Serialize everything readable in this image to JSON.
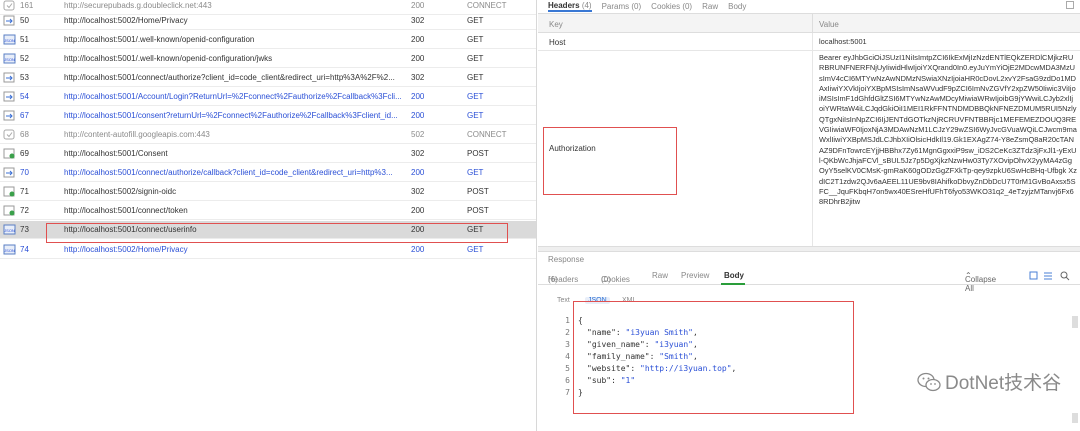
{
  "requests": [
    {
      "id": "161",
      "url": "http://securepubads.g.doubleclick.net:443",
      "status": "200",
      "method": "CONNECT",
      "style": "grey"
    },
    {
      "id": "50",
      "url": "http://localhost:5002/Home/Privacy",
      "status": "302",
      "method": "GET",
      "style": ""
    },
    {
      "id": "51",
      "url": "http://localhost:5001/.well-known/openid-configuration",
      "status": "200",
      "method": "GET",
      "style": ""
    },
    {
      "id": "52",
      "url": "http://localhost:5001/.well-known/openid-configuration/jwks",
      "status": "200",
      "method": "GET",
      "style": ""
    },
    {
      "id": "53",
      "url": "http://localhost:5001/connect/authorize?client_id=code_client&redirect_uri=http%3A%2F%2...",
      "status": "302",
      "method": "GET",
      "style": ""
    },
    {
      "id": "54",
      "url": "http://localhost:5001/Account/Login?ReturnUrl=%2Fconnect%2Fauthorize%2Fcallback%3Fcli...",
      "status": "200",
      "method": "GET",
      "style": "blue"
    },
    {
      "id": "67",
      "url": "http://localhost:5001/consent?returnUrl=%2Fconnect%2Fauthorize%2Fcallback%3Fclient_id...",
      "status": "200",
      "method": "GET",
      "style": "blue"
    },
    {
      "id": "68",
      "url": "http://content-autofill.googleapis.com:443",
      "status": "502",
      "method": "CONNECT",
      "style": "grey"
    },
    {
      "id": "69",
      "url": "http://localhost:5001/Consent",
      "status": "302",
      "method": "POST",
      "style": ""
    },
    {
      "id": "70",
      "url": "http://localhost:5001/connect/authorize/callback?client_id=code_client&redirect_uri=http%3...",
      "status": "200",
      "method": "GET",
      "style": "blue"
    },
    {
      "id": "71",
      "url": "http://localhost:5002/signin-oidc",
      "status": "302",
      "method": "POST",
      "style": ""
    },
    {
      "id": "72",
      "url": "http://localhost:5001/connect/token",
      "status": "200",
      "method": "POST",
      "style": ""
    },
    {
      "id": "73",
      "url": "http://localhost:5001/connect/userinfo",
      "status": "200",
      "method": "GET",
      "style": "sel"
    },
    {
      "id": "74",
      "url": "http://localhost:5002/Home/Privacy",
      "status": "200",
      "method": "GET",
      "style": "blue"
    }
  ],
  "request_tabs": {
    "headers": "Headers",
    "headers_count": "(4)",
    "params": "Params",
    "params_count": "(0)",
    "cookies": "Cookies",
    "cookies_count": "(0)",
    "raw": "Raw",
    "body": "Body"
  },
  "kv_header": {
    "key": "Key",
    "value": "Value"
  },
  "kv": {
    "host_key": "Host",
    "host_value": "localhost:5001",
    "auth_key": "Authorization",
    "auth_value": "Bearer eyJhbGciOiJSUzI1NiIsImtpZCI6IkExMjIzNzdENTlEQkZERDlCMjkzRURBRUNFNERFNjUyIiwidHlwIjoiYXQrand0In0.eyJuYmYiOjE2MDcwMDA3MzUsImV4cCI6MTYwNzAwNDMzNSwiaXNzIjoiaHR0cDovL2xvY2FsaG9zdDo1MDAxIiwiYXVkIjoiYXBpMSIsImNsaWVudF9pZCI6ImNvZGVfY2xpZW50Iiwic3ViIjoiMSIsImF1dGhfdGltZSI6MTYwNzAwMDcyMiwiaWRwIjoibG9jYWwiLCJyb2xlIjoiYWRtaW4iLCJqdGkiOiI1MEI1RkFFNTNDMDBBQkNFNEZDMUM5RUI5NzlyQTgxNiIsInNpZCI6IjJENTdGOTkzNjRCRUVFNTBBRjc1MEFEMEZDOUQ3REVGIiwiaWF0IjoxNjA3MDAwNzM1LCJzY29wZSI6WyJvcGVuaWQiLCJwcm9maWxlIiwiYXBpMSJdLCJhbXIiOlsicHdkIl19.Gk1EXAgZ74-Y8eZsmQ8aR20cTANAZ9DFnTowrcEYjjHBBhx7Zy61MgnGgxxiP9sw_iDS2CeKc3ZTdz3jFxJl1-yExUl-QKbWcJhjaFCVl_sBUL5Jz7p5DgXjkzNzwHw03Ty7XOvipOhvX2yyMA4zGgOyY5selKV0CMsK-gmRaK60gODzGgZFXkTp-qey9zpkU6SwHcBHq-Ufbgk XzdIC2T1zdw2QJv6aAEEL11UE9bv8IAhifkoDbvyZnDbDcU7T0rM1GvBoAxsx5SFC__JquFKbqH7on5wx40ESreHfUFhT6fyo53WKO31q2_4eTzyjzMTanvj6Fx68RDhrB2jitw"
  },
  "response": {
    "label": "Response",
    "headers": "Headers",
    "headers_count": "(6)",
    "cookies": "Cookies",
    "cookies_count": "(0)",
    "raw": "Raw",
    "preview": "Preview",
    "body": "Body",
    "collapse_all": "Collapse All",
    "subtabs": {
      "text": "Text",
      "json": "JSON",
      "xml": "XML"
    }
  },
  "code_lines": [
    {
      "n": "1",
      "text": "{"
    },
    {
      "n": "2",
      "key": "\"name\"",
      "val": "\"i3yuan Smith\""
    },
    {
      "n": "3",
      "key": "\"given_name\"",
      "val": "\"i3yuan\""
    },
    {
      "n": "4",
      "key": "\"family_name\"",
      "val": "\"Smith\""
    },
    {
      "n": "5",
      "key": "\"website\"",
      "val": "\"http://i3yuan.top\""
    },
    {
      "n": "6",
      "key": "\"sub\"",
      "val": "\"1\""
    },
    {
      "n": "7",
      "text": "}"
    }
  ],
  "watermark": {
    "text": "DotNet技术谷"
  },
  "colors": {
    "accent": "#3a78d4",
    "highlight": "#e05050",
    "link": "#2a4fd6",
    "body_tab_underline": "#2a9d3a"
  }
}
